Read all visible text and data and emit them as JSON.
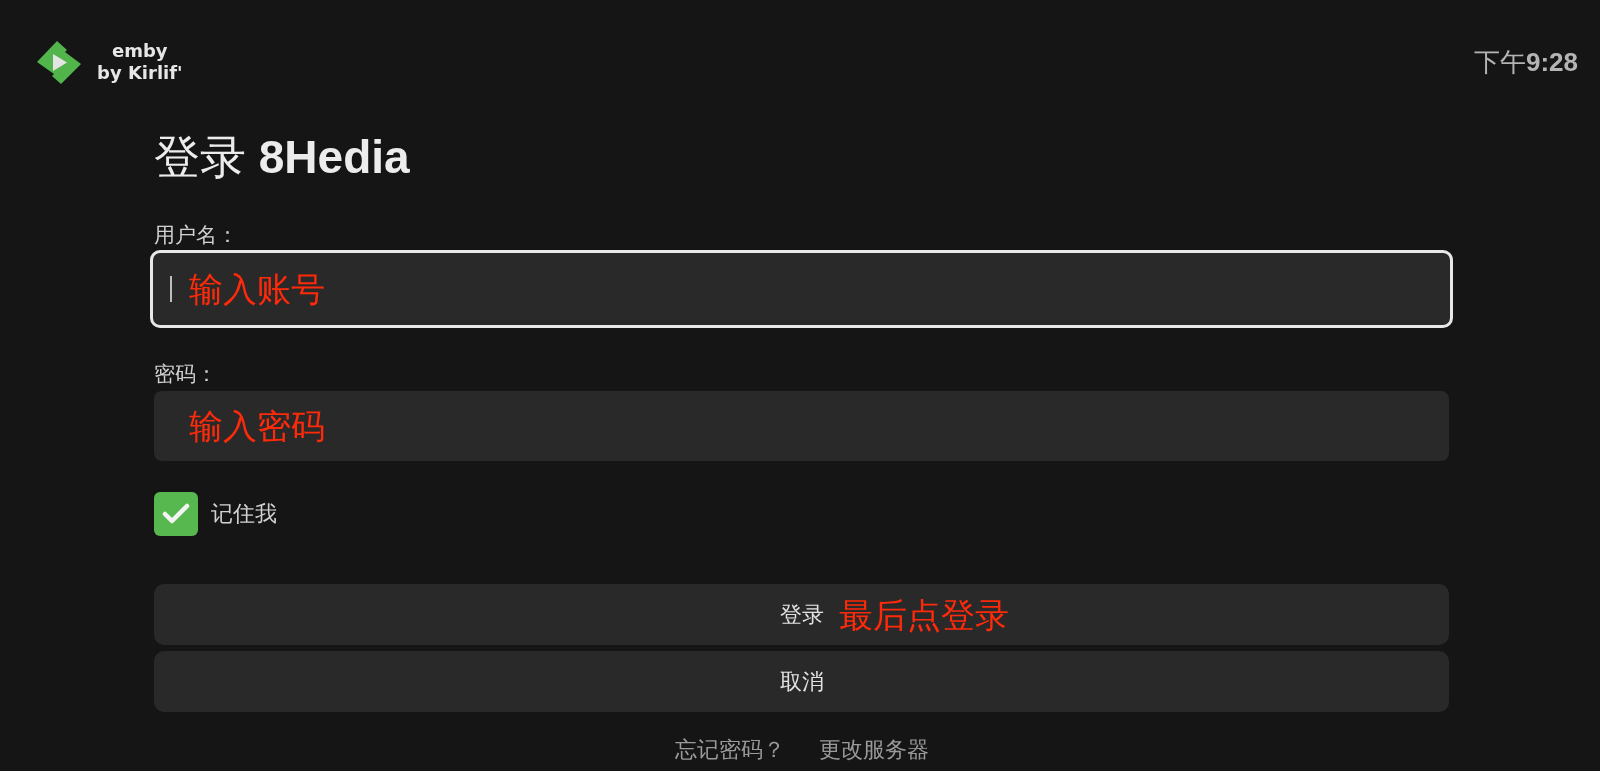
{
  "header": {
    "logo": {
      "name": "emby",
      "tagline": "by Kirlif'"
    },
    "clock": "下午**9:28**"
  },
  "login": {
    "title": "登录 **8Hedia**",
    "fields": [
      {
        "label": "用户名：",
        "focused": true,
        "annotation": "输入账号"
      },
      {
        "label": "密码：",
        "focused": false,
        "annotation": "输入密码"
      }
    ],
    "remember": {
      "label": "记住我",
      "checked": true
    },
    "buttons": [
      {
        "label": "登录",
        "annotation": "最后点登录"
      },
      {
        "label": "取消"
      }
    ],
    "links": [
      "忘记密码？",
      "更改服务器"
    ]
  }
}
